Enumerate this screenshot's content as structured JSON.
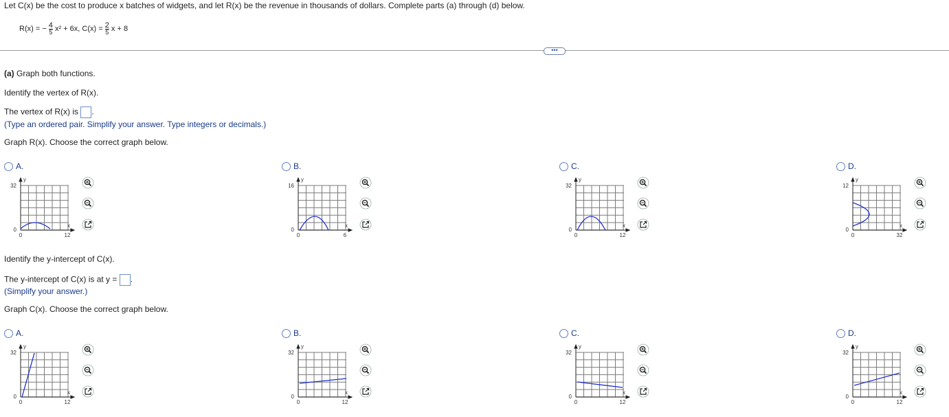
{
  "problem": {
    "intro": "Let C(x) be the cost to produce x batches of widgets, and let R(x) be the revenue in thousands of dollars. Complete parts (a) through (d) below.",
    "r_prefix": "R(x) = −",
    "r_num": "4",
    "r_den": "5",
    "r_rest": "x² + 6x, C(x) =",
    "c_num": "2",
    "c_den": "5",
    "c_rest": "x + 8"
  },
  "more_label": "•••",
  "part_a": {
    "title_bold": "(a)",
    "title_rest": " Graph both functions.",
    "identify_vertex": "Identify the vertex of R(x).",
    "vertex_prompt": "The vertex of R(x) is",
    "vertex_value": "",
    "vertex_hint": "(Type an ordered pair. Simplify your answer. Type integers or decimals.)",
    "graph_r_prompt": "Graph R(x). Choose the correct graph below.",
    "identify_intercept": "Identify the y-intercept of C(x).",
    "intercept_prompt": "The y-intercept of C(x) is at y =",
    "intercept_value": "",
    "intercept_hint": "(Simplify your answer.)",
    "graph_c_prompt": "Graph C(x). Choose the correct graph below."
  },
  "choices_r": [
    {
      "letter": "A.",
      "ymax_label": "32",
      "xmax_label": "12",
      "origin_label": "0",
      "zero_label": "0",
      "xaxis": "x",
      "yaxis": "y"
    },
    {
      "letter": "B.",
      "ymax_label": "16",
      "xmax_label": "6",
      "origin_label": "0",
      "zero_label": "0",
      "xaxis": "x",
      "yaxis": "y"
    },
    {
      "letter": "C.",
      "ymax_label": "32",
      "xmax_label": "12",
      "origin_label": "0",
      "zero_label": "0",
      "xaxis": "x",
      "yaxis": "y"
    },
    {
      "letter": "D.",
      "ymax_label": "12",
      "xmax_label": "32",
      "origin_label": "0",
      "zero_label": "0",
      "xaxis": "x",
      "yaxis": "y"
    }
  ],
  "choices_c": [
    {
      "letter": "A.",
      "ymax_label": "32",
      "xmax_label": "12",
      "origin_label": "0",
      "zero_label": "0",
      "xaxis": "x",
      "yaxis": "y"
    },
    {
      "letter": "B.",
      "ymax_label": "32",
      "xmax_label": "12",
      "origin_label": "0",
      "zero_label": "0",
      "xaxis": "x",
      "yaxis": "y"
    },
    {
      "letter": "C.",
      "ymax_label": "32",
      "xmax_label": "12",
      "origin_label": "0",
      "zero_label": "0",
      "xaxis": "x",
      "yaxis": "y"
    },
    {
      "letter": "D.",
      "ymax_label": "32",
      "xmax_label": "12",
      "origin_label": "0",
      "zero_label": "0",
      "xaxis": "x",
      "yaxis": "y"
    }
  ],
  "colors": {
    "curve": "#1f2fd0",
    "grid": "#7a7a7a",
    "accent": "#1a3a8a",
    "radio": "#5f7fc0"
  },
  "icons": {
    "zoom_in": "zoom-in-icon",
    "zoom_out": "zoom-out-icon",
    "popout": "popout-icon"
  }
}
